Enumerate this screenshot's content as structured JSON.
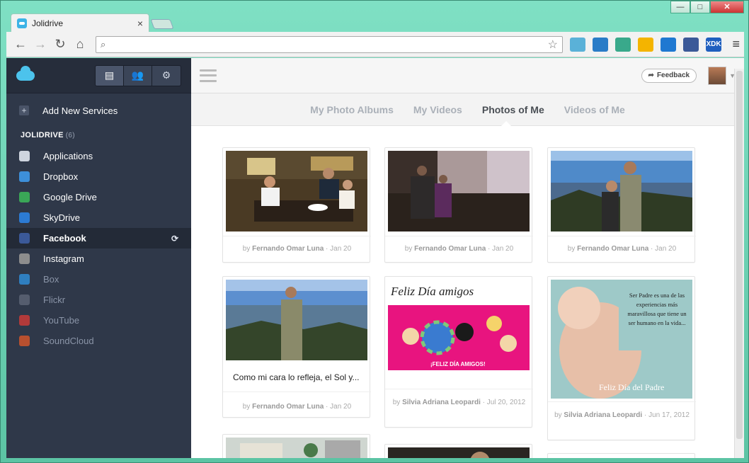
{
  "browser": {
    "tab_title": "Jolidrive",
    "tab_close": "×",
    "address": "",
    "window_buttons": [
      "—",
      "□",
      "✕"
    ],
    "extensions": [
      {
        "name": "map-extension-icon",
        "color": "#5ab1d8"
      },
      {
        "name": "picture-extension-icon",
        "color": "#2a7cc7"
      },
      {
        "name": "swirl-extension-icon",
        "color": "#39a98b"
      },
      {
        "name": "google-drive-extension-icon",
        "color": "#f4b400"
      },
      {
        "name": "blue-orb-extension-icon",
        "color": "#1f78d1"
      },
      {
        "name": "facebook-extension-icon",
        "color": "#3b5998"
      },
      {
        "name": "xdk-extension-icon",
        "color": "#1f5fbf",
        "text": "XDK"
      }
    ]
  },
  "sidebar": {
    "tabs": [
      "drawer-icon",
      "users-icon",
      "gear-icon"
    ],
    "add_services": "Add New Services",
    "section_title": "JOLIDRIVE",
    "section_count": "(6)",
    "items": [
      {
        "label": "Applications",
        "icon": "applications-icon",
        "color": "#cfd5df",
        "dim": false
      },
      {
        "label": "Dropbox",
        "icon": "dropbox-icon",
        "color": "#3d8fd9",
        "dim": false
      },
      {
        "label": "Google Drive",
        "icon": "google-drive-icon",
        "color": "#3aa657",
        "dim": false
      },
      {
        "label": "SkyDrive",
        "icon": "skydrive-icon",
        "color": "#2c7bd4",
        "dim": false
      },
      {
        "label": "Facebook",
        "icon": "facebook-icon",
        "color": "#3b5998",
        "dim": false,
        "active": true
      },
      {
        "label": "Instagram",
        "icon": "instagram-icon",
        "color": "#8d8d8d",
        "dim": false
      },
      {
        "label": "Box",
        "icon": "box-icon",
        "color": "#2f7fc0",
        "dim": true
      },
      {
        "label": "Flickr",
        "icon": "flickr-icon",
        "color": "#555d6e",
        "dim": true
      },
      {
        "label": "YouTube",
        "icon": "youtube-icon",
        "color": "#b23a3a",
        "dim": true
      },
      {
        "label": "SoundCloud",
        "icon": "soundcloud-icon",
        "color": "#b8502f",
        "dim": true
      }
    ]
  },
  "topbar": {
    "feedback": "Feedback"
  },
  "tabs": [
    "My Photo Albums",
    "My Videos",
    "Photos of Me",
    "Videos of Me"
  ],
  "active_tab": "Photos of Me",
  "cards": [
    {
      "by": "by",
      "author": "Fernando Omar Luna",
      "date": "Jan 20",
      "caption": ""
    },
    {
      "by": "by",
      "author": "Fernando Omar Luna",
      "date": "Jan 20",
      "caption": ""
    },
    {
      "by": "by",
      "author": "Fernando Omar Luna",
      "date": "Jan 20",
      "caption": ""
    },
    {
      "by": "by",
      "author": "Fernando Omar Luna",
      "date": "Jan 20",
      "caption": "Como mi cara lo refleja, el Sol y..."
    },
    {
      "by": "by",
      "author": "Silvia Adriana Leopardi",
      "date": "Jul 20, 2012",
      "caption": "",
      "image_text": "¡FELIZ DÍA AMIGOS!",
      "handwriting": "Feliz Día amigos"
    },
    {
      "by": "by",
      "author": "Silvia Adriana Leopardi",
      "date": "Jun 17, 2012",
      "caption": "",
      "image_text": "Ser Padre es una de las experiencias más maravillosa que tiene un ser humano en la vida...",
      "image_title": "Feliz Día del Padre"
    }
  ]
}
